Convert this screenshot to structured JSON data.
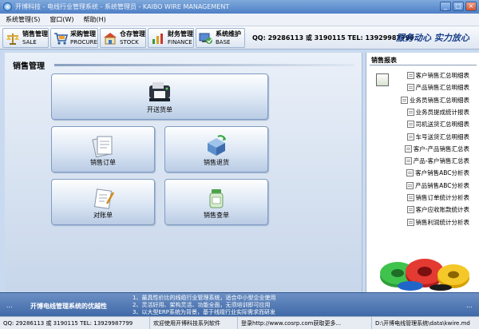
{
  "window": {
    "title": "开博科技 - 电线行业管理系统 - 系统管理员 - KAIBO WIRE MANAGEMENT"
  },
  "menu": [
    "系统管理(S)",
    "窗口(W)",
    "帮助(H)"
  ],
  "toolbar": {
    "buttons": [
      {
        "cn": "销售管理",
        "en": "SALE"
      },
      {
        "cn": "采购管理",
        "en": "PROCURE"
      },
      {
        "cn": "仓存管理",
        "en": "STOCK"
      },
      {
        "cn": "财务管理",
        "en": "FINANCE"
      },
      {
        "cn": "系统维护",
        "en": "BASE"
      }
    ],
    "contact": "QQ: 29286113 或 3190115  TEL: 13929987799",
    "slogan": "服务动心 实力放心"
  },
  "main": {
    "title": "销售管理",
    "tiles": [
      {
        "label": "开送货单"
      },
      {
        "label": "销售订单"
      },
      {
        "label": "销售退货"
      },
      {
        "label": "对账单"
      },
      {
        "label": "销售查单"
      }
    ]
  },
  "reports": {
    "title": "销售报表",
    "items": [
      "客户销售汇总明细表",
      "产品销售汇总明细表",
      "业务员销售汇总明细表",
      "业务员提成统计报表",
      "司机送货汇总明细表",
      "车号送货汇总明细表",
      "客户-产品销售汇总表",
      "产品-客户销售汇总表",
      "客户销售ABC分析表",
      "产品销售ABC分析表",
      "销售订单统计分析表",
      "客户应收账款统计表",
      "销售利润统计分析表"
    ]
  },
  "footer": {
    "title": "开博电线管理系统的优越性",
    "lines": [
      "1、最具性价比的线缆行业管理系统，适合中小型企业使用",
      "2、灵活好用、架构灵活、功能全面，无须培训即可应用",
      "3、以大型ERP系统为背景，基于线缆行业实际需求而研发"
    ],
    "dots": "..."
  },
  "status": {
    "contact": "QQ: 29286113 或 3190115  TEL: 13929987799",
    "welcome": "欢迎使用开博科技系列软件",
    "website": "登录http://www.cosrp.com获取更多...",
    "path": "D:\\开博电线管理系统\\data\\kwire.md"
  }
}
